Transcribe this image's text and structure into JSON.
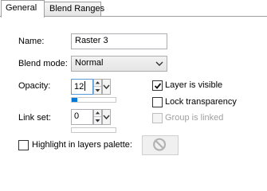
{
  "tabs": [
    {
      "label": "General",
      "active": true
    },
    {
      "label": "Blend Ranges",
      "active": false
    }
  ],
  "general": {
    "name_label": "Name:",
    "name_value": "Raster 3",
    "blend_mode_label": "Blend mode:",
    "blend_mode_value": "Normal",
    "opacity_label": "Opacity:",
    "opacity_value": "12",
    "opacity_level": 0.12,
    "link_set_label": "Link set:",
    "link_set_value": "0",
    "layer_visible_label": "Layer is visible",
    "layer_visible_checked": true,
    "lock_transparency_label": "Lock transparency",
    "lock_transparency_checked": false,
    "group_linked_label": "Group is linked",
    "group_linked_checked": false,
    "group_linked_enabled": false,
    "highlight_label": "Highlight in layers palette:",
    "highlight_checked": false,
    "highlight_icon": "no-color-icon"
  },
  "colors": {
    "accent": "#0078d7",
    "focus_border": "#5b9bd5",
    "disabled_text": "#a0a0a0"
  }
}
